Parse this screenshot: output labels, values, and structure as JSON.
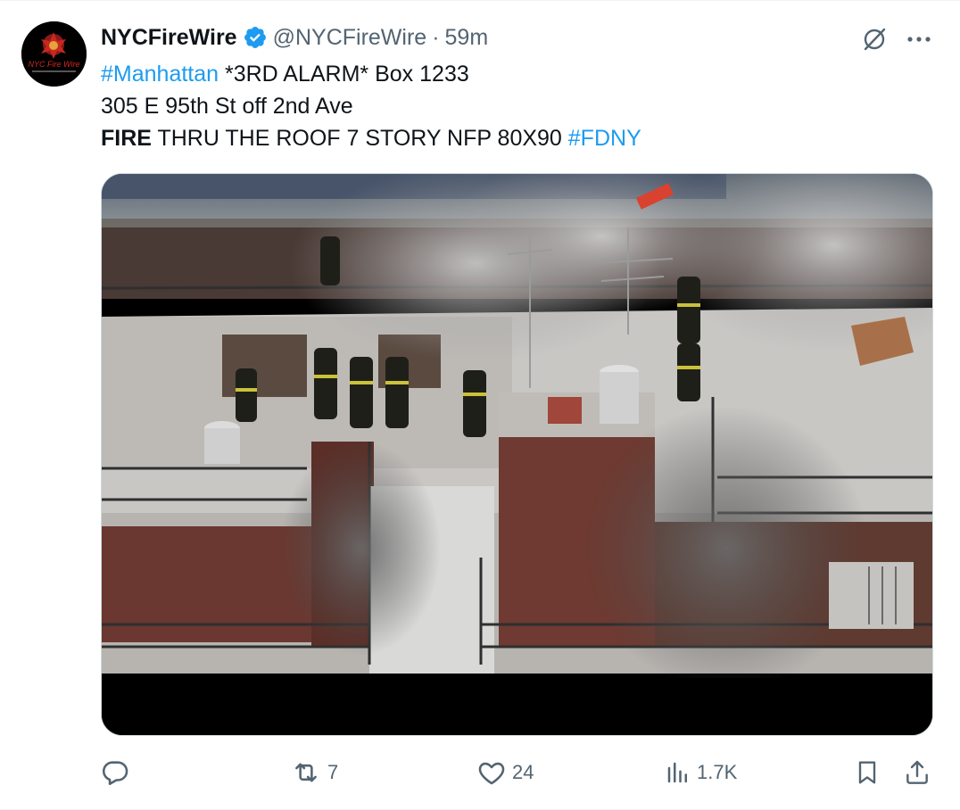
{
  "author": {
    "display_name": "NYCFireWire",
    "handle": "@NYCFireWire",
    "separator": "·",
    "time": "59m",
    "avatar_text": "NYC Fire Wire"
  },
  "tweet": {
    "line1_hashtag": "#Manhattan",
    "line1_text": " *3RD ALARM* Box 1233",
    "line2": "305 E 95th St off 2nd Ave",
    "line3_bold": "FIRE",
    "line3_text": " THRU THE ROOF 7 STORY NFP 80X90 ",
    "line3_hashtag": "#FDNY"
  },
  "media": {
    "description_icon": "video-thumbnail"
  },
  "actions": {
    "reply_count": "",
    "retweet_count": "7",
    "like_count": "24",
    "views_count": "1.7K"
  },
  "colors": {
    "accent": "#1d9bf0",
    "muted": "#536471",
    "text": "#0f1419"
  },
  "icons": [
    "verified-badge-icon",
    "grok-icon",
    "more-icon",
    "reply-icon",
    "retweet-icon",
    "like-icon",
    "views-icon",
    "bookmark-icon",
    "share-icon"
  ]
}
